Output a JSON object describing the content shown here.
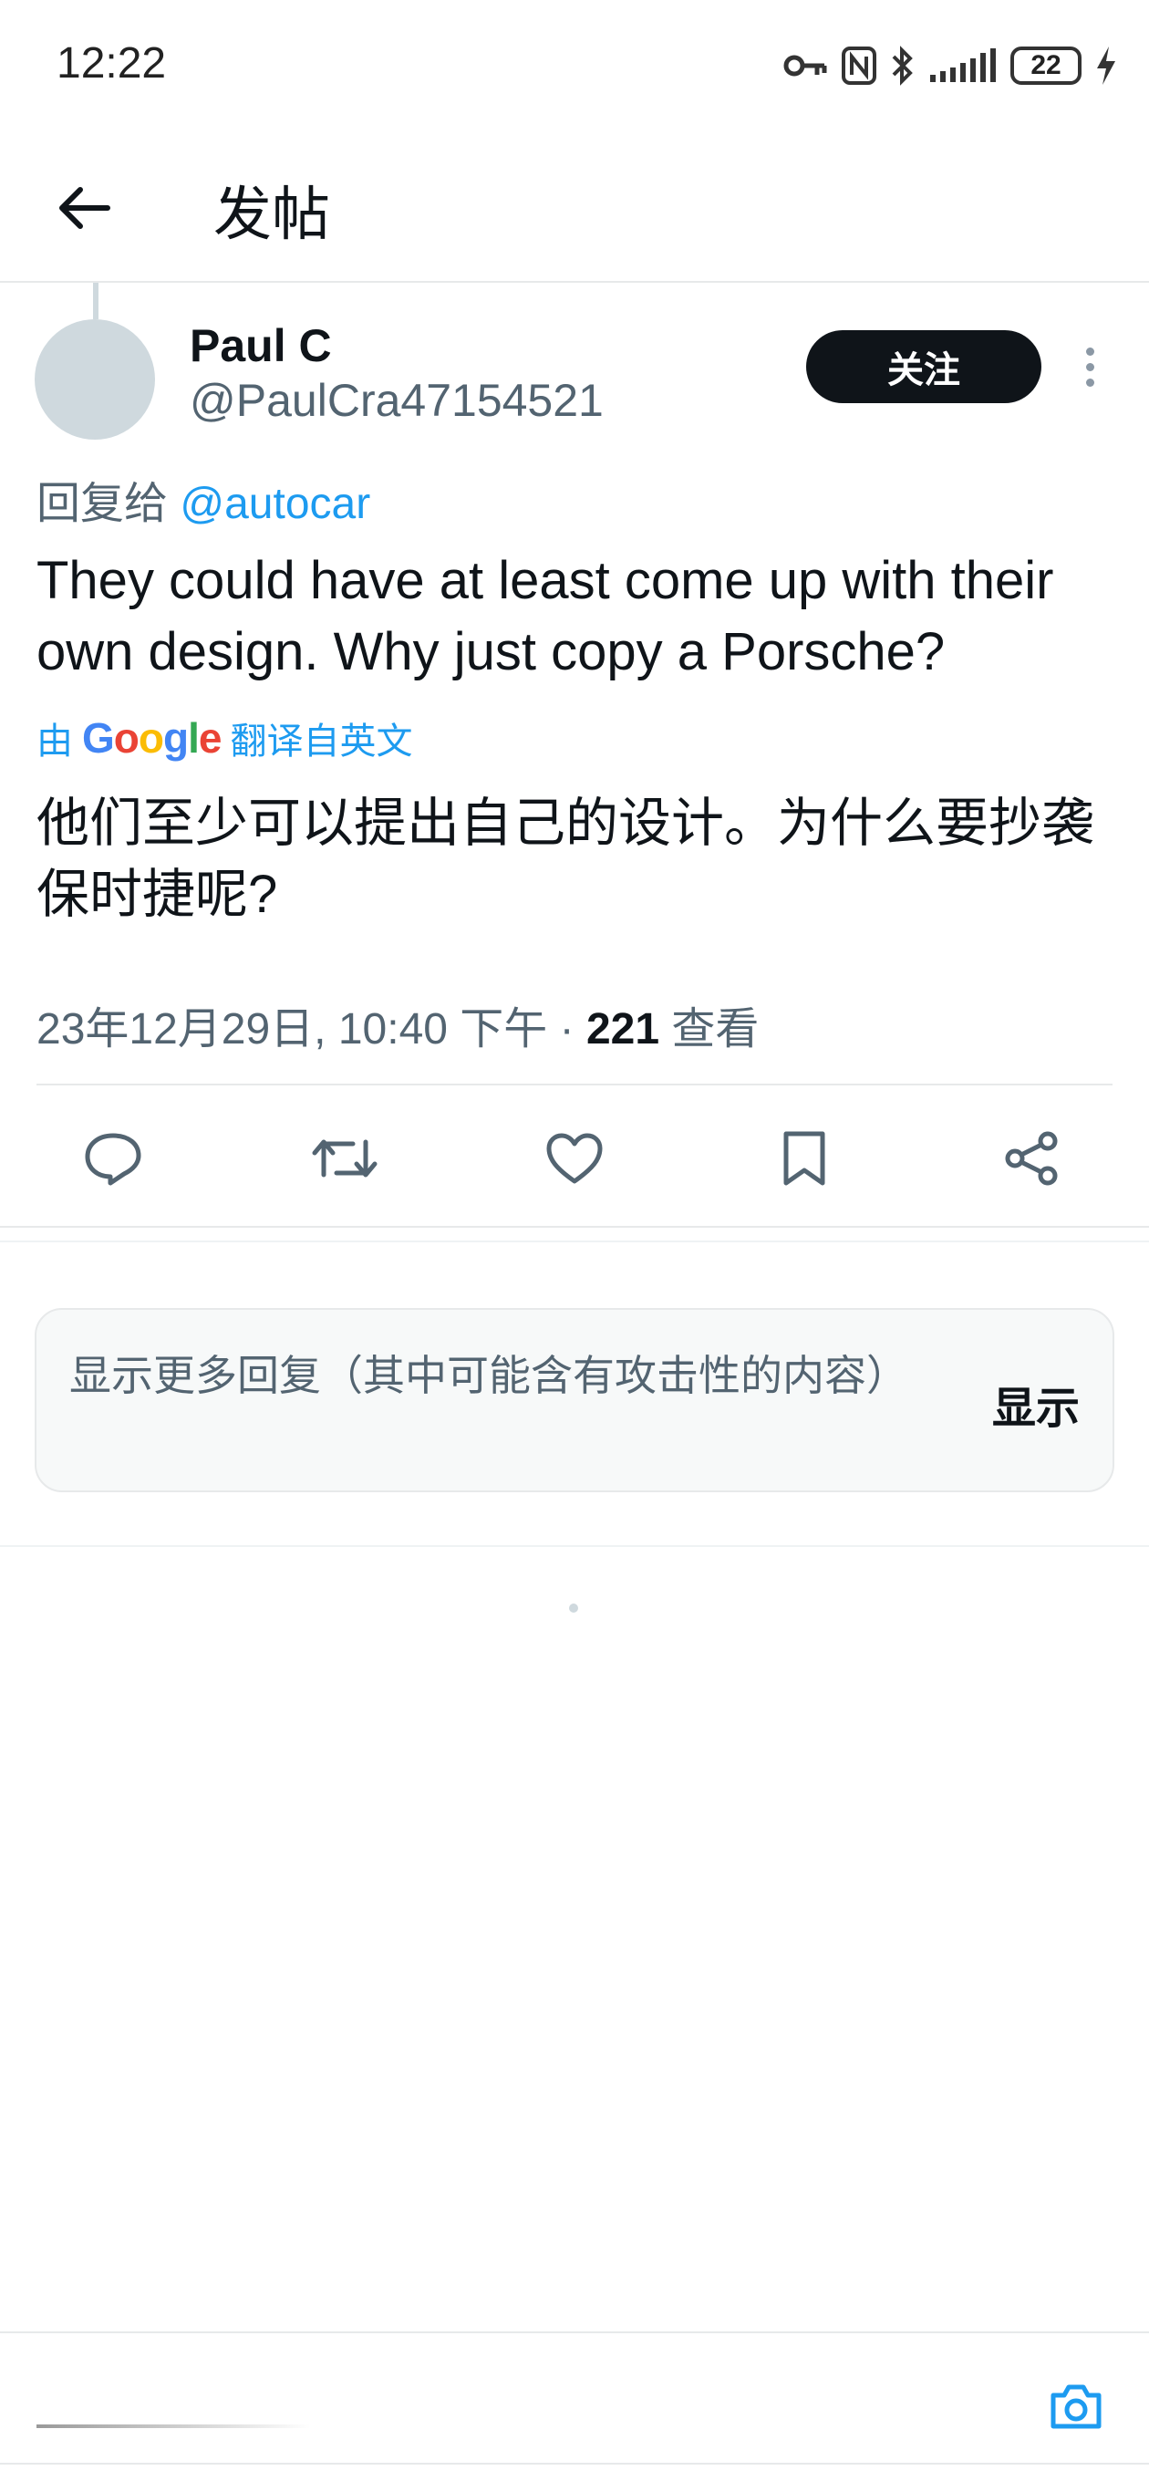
{
  "status_bar": {
    "time": "12:22",
    "battery": "22",
    "icons": [
      "key-icon",
      "nfc-icon",
      "bluetooth-icon",
      "signal-icon",
      "battery-icon",
      "charging-icon"
    ]
  },
  "header": {
    "title": "发帖",
    "back_icon": "arrow-left-icon"
  },
  "post": {
    "author": {
      "display_name": "Paul C",
      "handle": "@PaulCra47154521"
    },
    "follow_label": "关注",
    "reply_prefix": "回复给",
    "reply_mention": "@autocar",
    "text": "They could have at least come up with their own design. Why just copy a Porsche?",
    "translation": {
      "prefix": "由",
      "provider": "Google",
      "suffix": "翻译自英文",
      "text": "他们至少可以提出自己的设计。为什么要抄袭保时捷呢?"
    },
    "meta": {
      "date": "23年12月29日, 10:40 下午 · ",
      "views": "221",
      "views_label": " 查看"
    },
    "actions": [
      "reply-icon",
      "repost-icon",
      "like-icon",
      "bookmark-icon",
      "share-icon"
    ]
  },
  "more_replies": {
    "text": "显示更多回复（其中可能含有攻击性的内容）",
    "button": "显示"
  },
  "compose": {
    "placeholder": "",
    "camera_icon": "camera-icon"
  },
  "colors": {
    "accent": "#1d9bf0",
    "text_primary": "#0f1419",
    "text_secondary": "#536471"
  }
}
